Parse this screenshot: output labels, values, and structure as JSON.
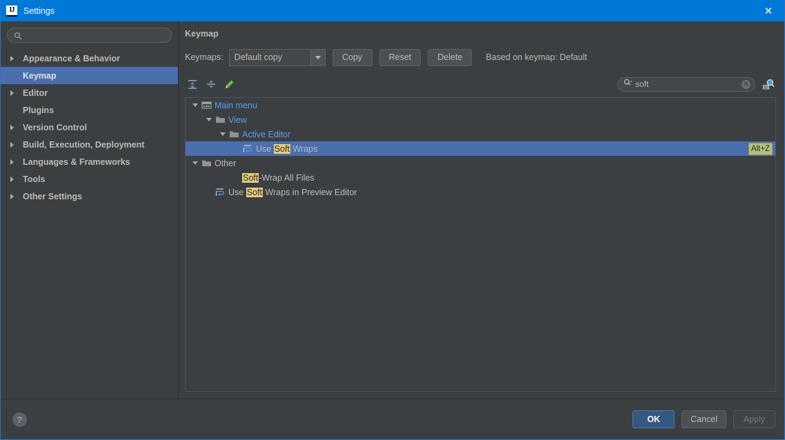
{
  "window": {
    "title": "Settings",
    "app_icon": "intellij-idea-icon",
    "close_icon": "close-icon",
    "titlebar_color": "#0078d7",
    "accent_color": "#4b6eaf",
    "highlight_color": "#e5cb7e"
  },
  "sidebar": {
    "search": {
      "value": "",
      "placeholder": "",
      "icon": "search-icon"
    },
    "items": [
      {
        "label": "Appearance & Behavior",
        "expandable": true,
        "selected": false
      },
      {
        "label": "Keymap",
        "expandable": false,
        "selected": true
      },
      {
        "label": "Editor",
        "expandable": true,
        "selected": false
      },
      {
        "label": "Plugins",
        "expandable": false,
        "selected": false
      },
      {
        "label": "Version Control",
        "expandable": true,
        "selected": false
      },
      {
        "label": "Build, Execution, Deployment",
        "expandable": true,
        "selected": false
      },
      {
        "label": "Languages & Frameworks",
        "expandable": true,
        "selected": false
      },
      {
        "label": "Tools",
        "expandable": true,
        "selected": false
      },
      {
        "label": "Other Settings",
        "expandable": true,
        "selected": false
      }
    ]
  },
  "content": {
    "title": "Keymap",
    "keymaps_label": "Keymaps:",
    "keymap_selected": "Default copy",
    "buttons": {
      "copy": "Copy",
      "reset": "Reset",
      "delete": "Delete"
    },
    "based_on": "Based on keymap: Default",
    "toolbar": {
      "expand_all_icon": "expand-all-icon",
      "collapse_all_icon": "collapse-all-icon",
      "edit_shortcut_icon": "edit-pencil-icon"
    },
    "shortcut_search": {
      "value": "soft",
      "icon": "search-icon",
      "clear_icon": "clear-circle-icon",
      "find_by_shortcut_icon": "find-by-shortcut-icon"
    }
  },
  "tree": [
    {
      "label_plain": "Main menu",
      "parts": [
        {
          "text": "Main menu",
          "hl": false
        }
      ],
      "indent": 0,
      "toggle": "expanded",
      "icon": "main-menu-icon",
      "link": true,
      "selected": false,
      "shortcut": ""
    },
    {
      "label_plain": "View",
      "parts": [
        {
          "text": "View",
          "hl": false
        }
      ],
      "indent": 1,
      "toggle": "expanded",
      "icon": "folder-icon",
      "link": true,
      "selected": false,
      "shortcut": ""
    },
    {
      "label_plain": "Active Editor",
      "parts": [
        {
          "text": "Active Editor",
          "hl": false
        }
      ],
      "indent": 2,
      "toggle": "expanded",
      "icon": "folder-icon",
      "link": true,
      "selected": false,
      "shortcut": ""
    },
    {
      "label_plain": "Use Soft Wraps",
      "parts": [
        {
          "text": "Use ",
          "hl": false
        },
        {
          "text": "Soft",
          "hl": true
        },
        {
          "text": " Wraps",
          "hl": false
        }
      ],
      "indent": 3,
      "toggle": "none",
      "icon": "soft-wrap-icon",
      "link": false,
      "selected": true,
      "shortcut": "Alt+Z"
    },
    {
      "label_plain": "Other",
      "parts": [
        {
          "text": "Other",
          "hl": false
        }
      ],
      "indent": 0,
      "toggle": "expanded",
      "icon": "other-group-icon",
      "link": false,
      "selected": false,
      "shortcut": ""
    },
    {
      "label_plain": "Soft-Wrap All Files",
      "parts": [
        {
          "text": "Soft",
          "hl": true
        },
        {
          "text": "-Wrap All Files",
          "hl": false
        }
      ],
      "indent": 2,
      "toggle": "none",
      "icon": "none",
      "link": false,
      "selected": false,
      "shortcut": ""
    },
    {
      "label_plain": "Use Soft Wraps in Preview Editor",
      "parts": [
        {
          "text": "Use ",
          "hl": false
        },
        {
          "text": "Soft",
          "hl": true
        },
        {
          "text": " Wraps in Preview Editor",
          "hl": false
        }
      ],
      "indent": 1,
      "toggle": "none",
      "icon": "soft-wrap-icon",
      "link": false,
      "selected": false,
      "shortcut": ""
    }
  ],
  "footer": {
    "help_label": "?",
    "ok": "OK",
    "cancel": "Cancel",
    "apply": "Apply",
    "apply_disabled": true
  }
}
